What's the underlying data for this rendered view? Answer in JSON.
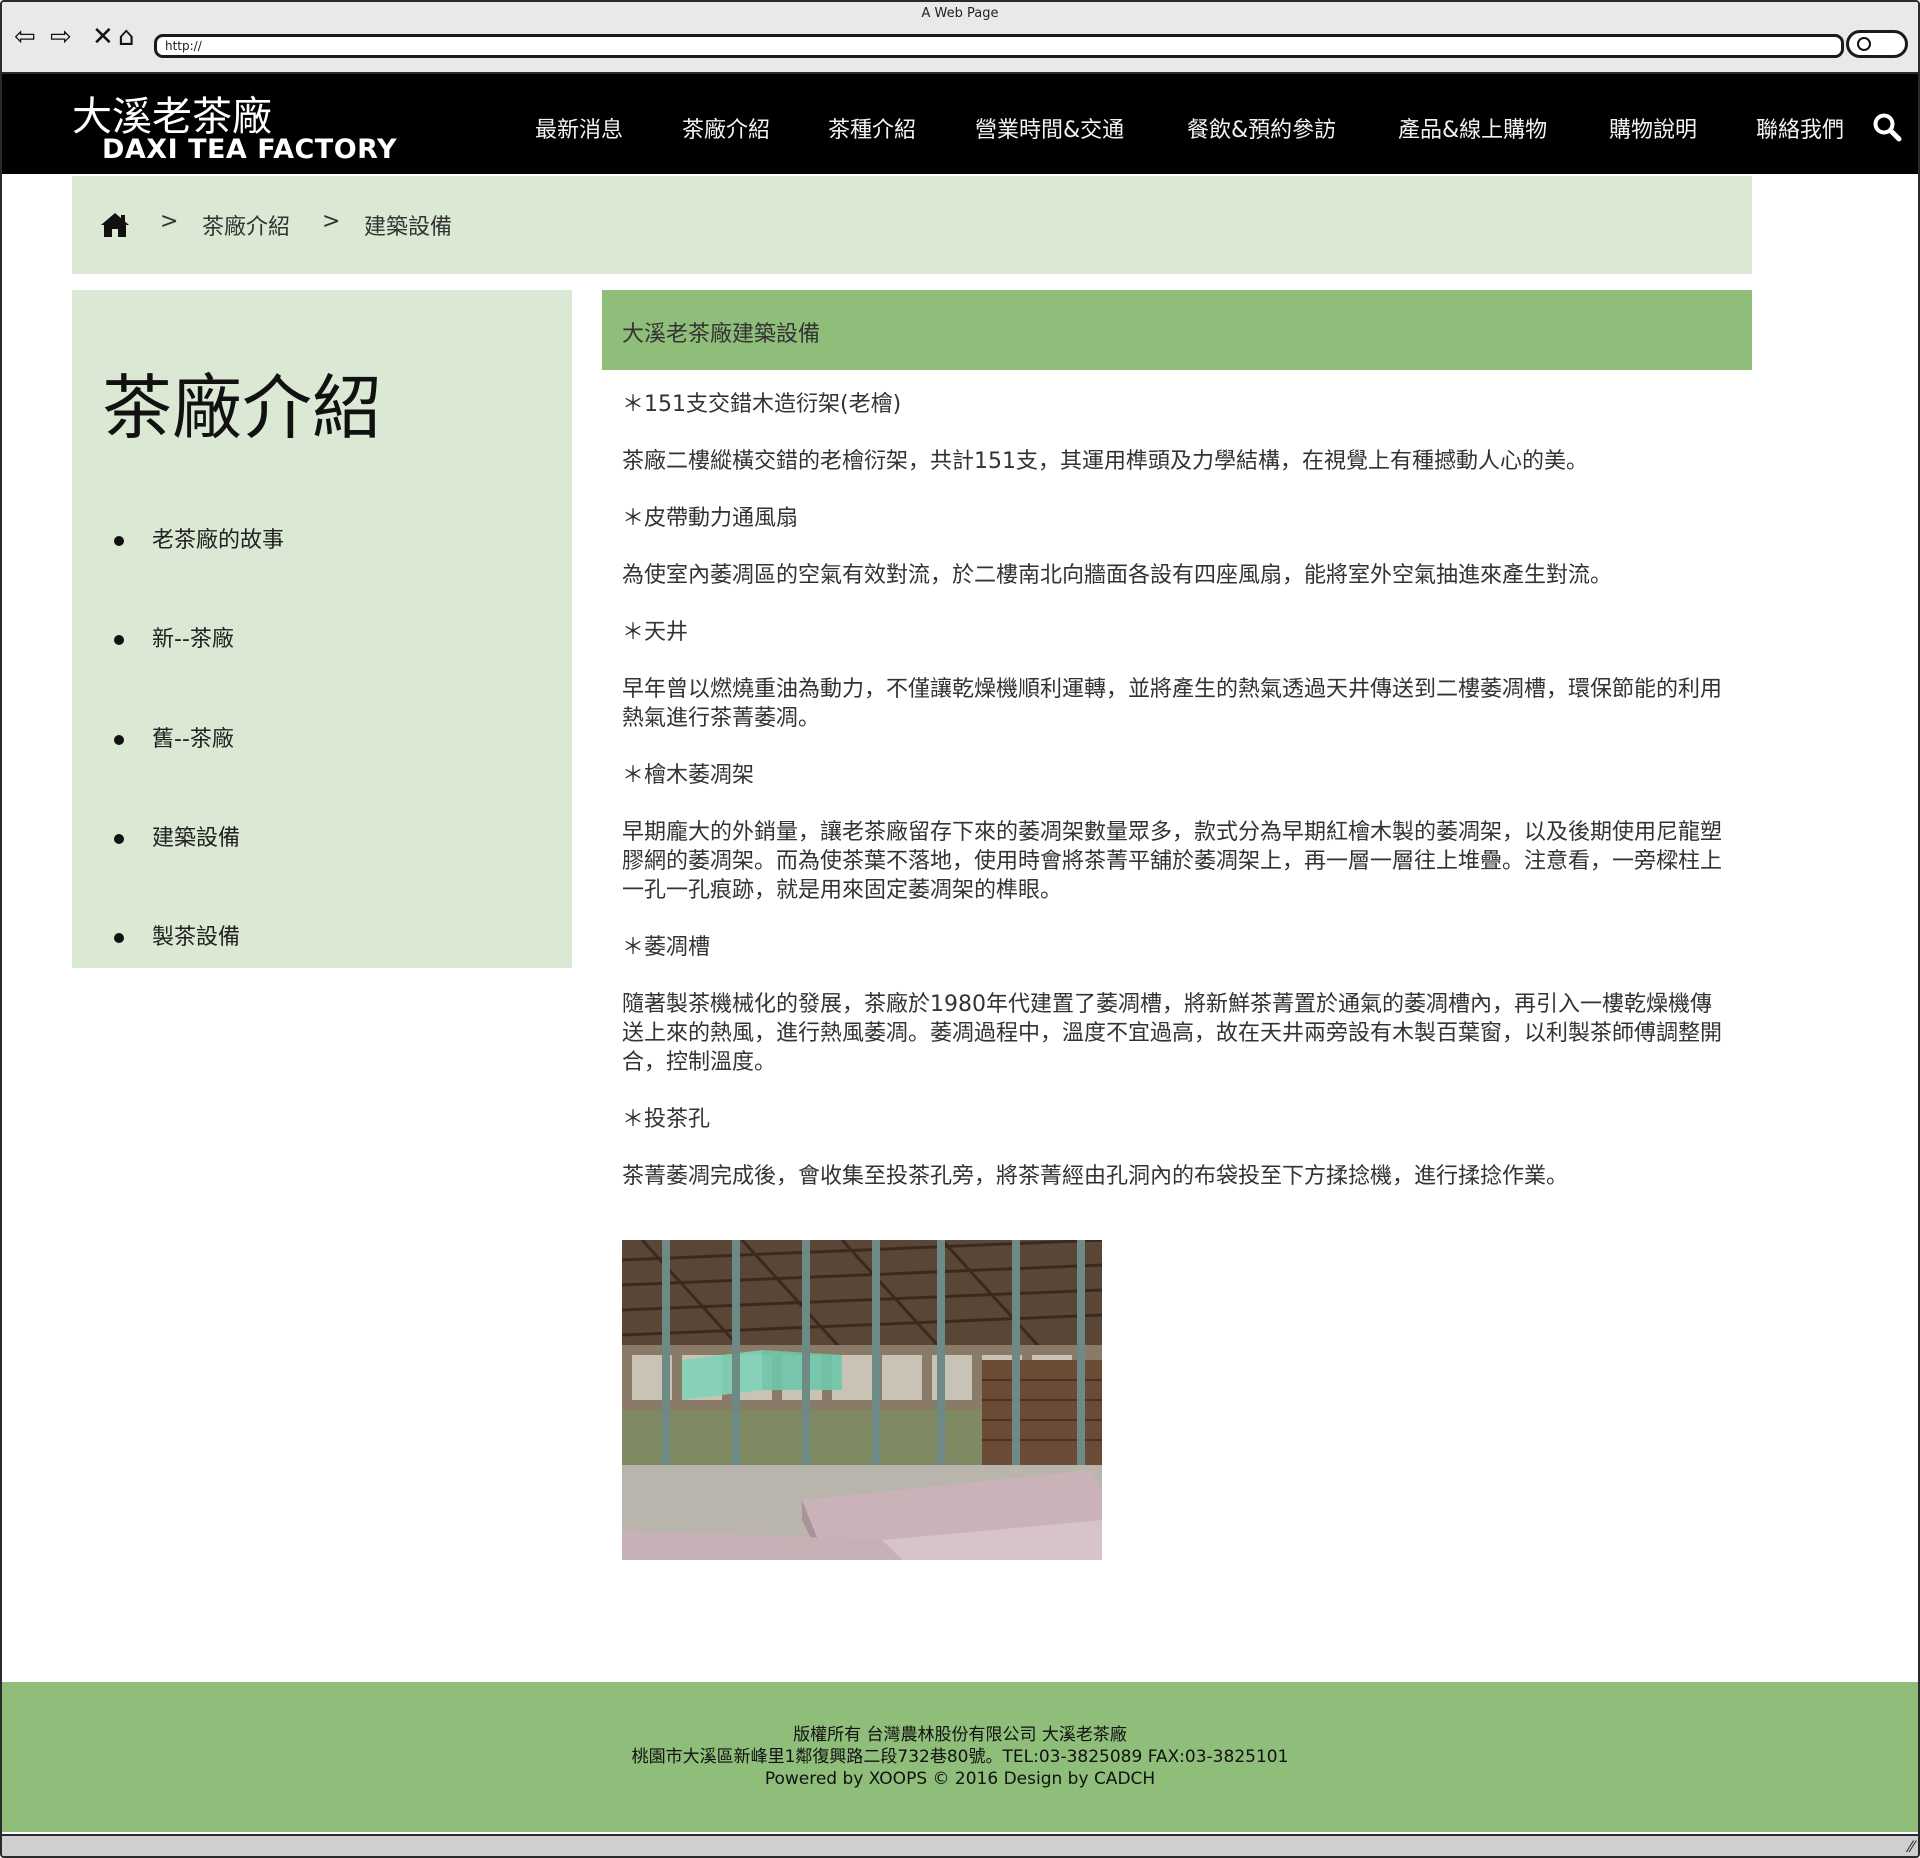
{
  "browser": {
    "window_title": "A Web Page",
    "url": "http://",
    "back_icon": "arrow-left-icon",
    "forward_icon": "arrow-right-icon",
    "stop_icon": "close-icon",
    "home_icon": "home-icon"
  },
  "header": {
    "logo_cn": "大溪老茶廠",
    "logo_en": "DAXI TEA FACTORY",
    "menu": [
      {
        "label": "最新消息"
      },
      {
        "label": "茶廠介紹"
      },
      {
        "label": "茶種介紹"
      },
      {
        "label": "營業時間&交通"
      },
      {
        "label": "餐飲&預約參訪"
      },
      {
        "label": "產品&線上購物"
      },
      {
        "label": "購物說明"
      },
      {
        "label": "聯絡我們"
      }
    ],
    "search_icon": "search-icon"
  },
  "breadcrumb": {
    "separator": ">",
    "items": [
      "茶廠介紹",
      "建築設備"
    ]
  },
  "sidebar": {
    "title": "茶廠介紹",
    "items": [
      {
        "label": "老茶廠的故事"
      },
      {
        "label": "新--茶廠"
      },
      {
        "label": "舊--茶廠"
      },
      {
        "label": "建築設備"
      },
      {
        "label": "製茶設備"
      }
    ]
  },
  "main": {
    "heading": "大溪老茶廠建築設備",
    "paragraphs": [
      "＊151支交錯木造衍架(老檜)",
      "茶廠二樓縱橫交錯的老檜衍架，共計151支，其運用榫頭及力學結構，在視覺上有種撼動人心的美。",
      "＊皮帶動力通風扇",
      "為使室內萎凋區的空氣有效對流，於二樓南北向牆面各設有四座風扇，能將室外空氣抽進來產生對流。",
      "＊天井",
      "早年曾以燃燒重油為動力，不僅讓乾燥機順利運轉，並將產生的熱氣透過天井傳送到二樓萎凋槽，環保節能的利用熱氣進行茶菁萎凋。",
      "＊檜木萎凋架",
      "早期龐大的外銷量，讓老茶廠留存下來的萎凋架數量眾多，款式分為早期紅檜木製的萎凋架，以及後期使用尼龍塑膠網的萎凋架。而為使茶葉不落地，使用時會將茶菁平舖於萎凋架上，再一層一層往上堆疊。注意看，一旁樑柱上一孔一孔痕跡，就是用來固定萎凋架的榫眼。",
      "＊萎凋槽",
      "隨著製茶機械化的發展，茶廠於1980年代建置了萎凋槽，將新鮮茶菁置於通氣的萎凋槽內，再引入一樓乾燥機傳送上來的熱風，進行熱風萎凋。萎凋過程中，溫度不宜過高，故在天井兩旁設有木製百葉窗，以利製茶師傅調整開合，控制溫度。",
      "＊投茶孔",
      "茶菁萎凋完成後，會收集至投茶孔旁，將茶菁經由孔洞內的布袋投至下方揉捻機，進行揉捻作業。"
    ]
  },
  "footer": {
    "line1": "版權所有 台灣農林股份有限公司 大溪老茶廠",
    "line2": "桃園市大溪區新峰里1鄰復興路二段732巷80號。TEL:03-3825089 FAX:03-3825101",
    "line3": "Powered by XOOPS © 2016 Design by CADCH"
  },
  "colors": {
    "header_bg": "#000000",
    "light_green": "#dbe9d4",
    "accent_green": "#8fbd7a"
  }
}
